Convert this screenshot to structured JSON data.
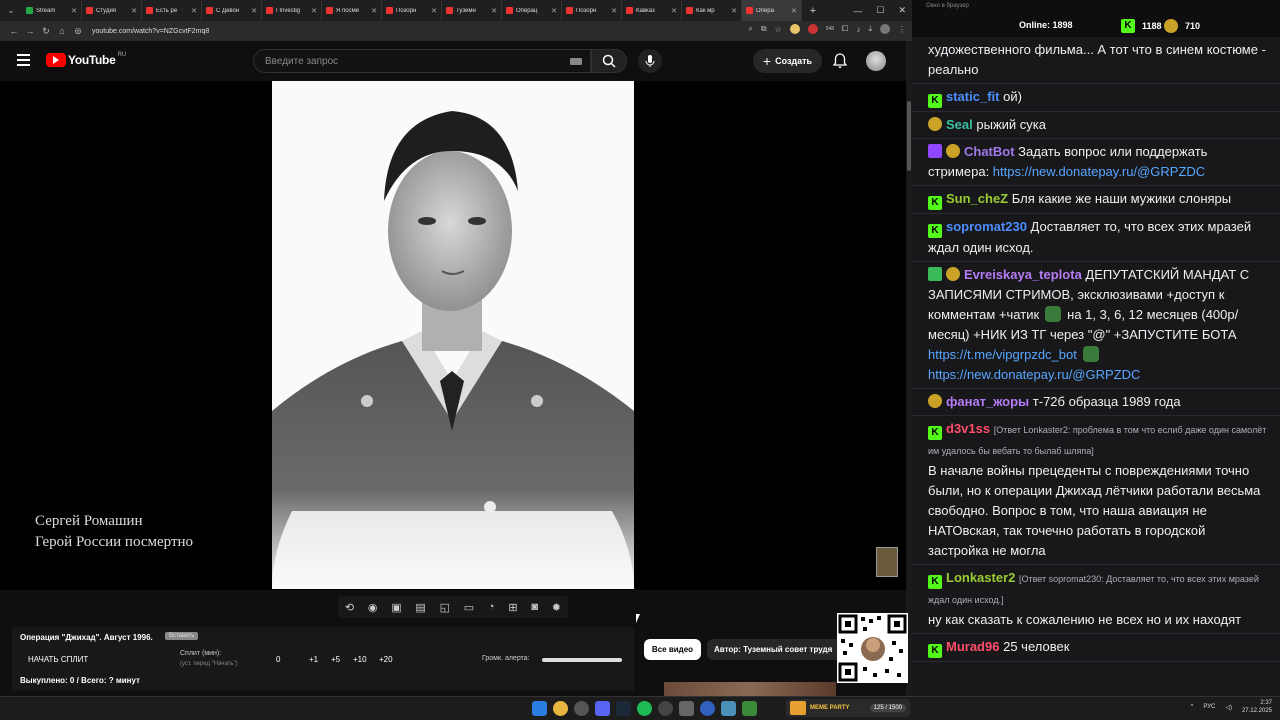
{
  "browser": {
    "tabs": [
      {
        "label": "Stream",
        "color": "#22aa44"
      },
      {
        "label": "Студия",
        "color": "#e33"
      },
      {
        "label": "Есть ре",
        "color": "#e33"
      },
      {
        "label": "С Девон",
        "color": "#e33"
      },
      {
        "label": "I Investig",
        "color": "#e33"
      },
      {
        "label": "Я посме",
        "color": "#e33"
      },
      {
        "label": "Позорн",
        "color": "#e33"
      },
      {
        "label": "Туземн",
        "color": "#e33"
      },
      {
        "label": "Операц",
        "color": "#e33"
      },
      {
        "label": "Позорн",
        "color": "#e33"
      },
      {
        "label": "Кавказ",
        "color": "#e33"
      },
      {
        "label": "Как мр",
        "color": "#e33"
      },
      {
        "label": "Опера",
        "color": "#e33",
        "active": true
      }
    ],
    "url": "youtube.com/watch?v=NZGcvtF2mq8",
    "ext_count": "548"
  },
  "youtube": {
    "logo_text": "YouTube",
    "region": "RU",
    "search_placeholder": "Введите запрос",
    "create_label": "Создать"
  },
  "video": {
    "caption_line1": "Сергей Ромашин",
    "caption_line2": "Герой России посмертно"
  },
  "overlay": {
    "title": "Операция \"Джихад\". Август 1996.",
    "badge": "Вставить",
    "start_split": "НАЧАТЬ СПЛИТ",
    "split_label": "Сплит (мин):",
    "split_sub": "(уст. перед \"Начать\")",
    "split_value": "0",
    "buttons": [
      "+1",
      "+5",
      "+10",
      "+20"
    ],
    "volume_label": "Громк. алерта:",
    "bought": "Выкуплено: 0 / Всего: ? минут"
  },
  "chips": {
    "all_videos": "Все видео",
    "author": "Автор: Туземный совет трудя"
  },
  "chat": {
    "window_title": "Окно в браузер",
    "online_label": "Online:",
    "online_count": "1898",
    "kick_count": "1188",
    "sub_count": "710",
    "top_text": "художественного фильма... А тот что в синем костюме - реально",
    "messages": [
      {
        "user": "static_fit",
        "color": "#4c8dff",
        "badges": [
          "k"
        ],
        "text": "ой)"
      },
      {
        "user": "Seal",
        "color": "#3cbfa0",
        "badges": [
          "s"
        ],
        "text": "рыжий сука"
      },
      {
        "user": "ChatBot",
        "color": "#9f7aea",
        "badges": [
          "bot",
          "s"
        ],
        "text": "Задать вопрос или поддержать стримера: ",
        "link": "https://new.donatepay.ru/@GRPZDC"
      },
      {
        "user": "Sun_cheZ",
        "color": "#9acd32",
        "badges": [
          "k"
        ],
        "text": "Бля какие же наши мужики слоняры"
      },
      {
        "user": "sopromat230",
        "color": "#4c8dff",
        "badges": [
          "k"
        ],
        "text": "Доставляет то, что всех этих мразей ждал один исход."
      },
      {
        "user": "Evreiskaya_teplota",
        "color": "#b57cf5",
        "badges": [
          "edit",
          "s"
        ],
        "text": "ДЕПУТАТСКИЙ МАНДАТ С ЗАПИСЯМИ СТРИМОВ, эксклюзивами +доступ к комментам +чатик",
        "text2": "на 1, 3, 6, 12 месяцев (400р/месяц) +НИК ИЗ ТГ через \"@\" +ЗАПУСТИТЕ БОТА",
        "link": "https://t.me/vipgrpzdc_bot",
        "link2": "https://new.donatepay.ru/@GRPZDC"
      },
      {
        "user": "фанат_жоры",
        "color": "#b57cf5",
        "badges": [
          "s"
        ],
        "text": "т-72б образца 1989 года"
      },
      {
        "user": "d3v1ss",
        "color": "#ff4d6a",
        "badges": [
          "k"
        ],
        "reply": "[Ответ Lonkaster2: проблема в том что еслиб даже один самолёт им удалось бы вебать то былаб шляпа]",
        "text": "В начале войны прецеденты с повреждениями точно были, но к операции Джихад лётчики работали весьма свободно. Вопрос в том, что наша авиация не НАТОвская, так точечно работать в городской застройка не могла"
      },
      {
        "user": "Lonkaster2",
        "color": "#9acd32",
        "badges": [
          "k"
        ],
        "reply": "[Ответ sopromat230: Доставляет то, что всех этих мразей ждал один исход.]",
        "text": "ну как сказать к сожалению не всех но и их находят"
      },
      {
        "user": "Murad96",
        "color": "#ff4d6a",
        "badges": [
          "k"
        ],
        "text": "25 человек"
      }
    ]
  },
  "taskbar": {
    "widget_text": "MEME PARTY",
    "widget_count": "125 / 1500",
    "lang": "РУС",
    "time": "2:37",
    "date": "27.12.2025"
  }
}
